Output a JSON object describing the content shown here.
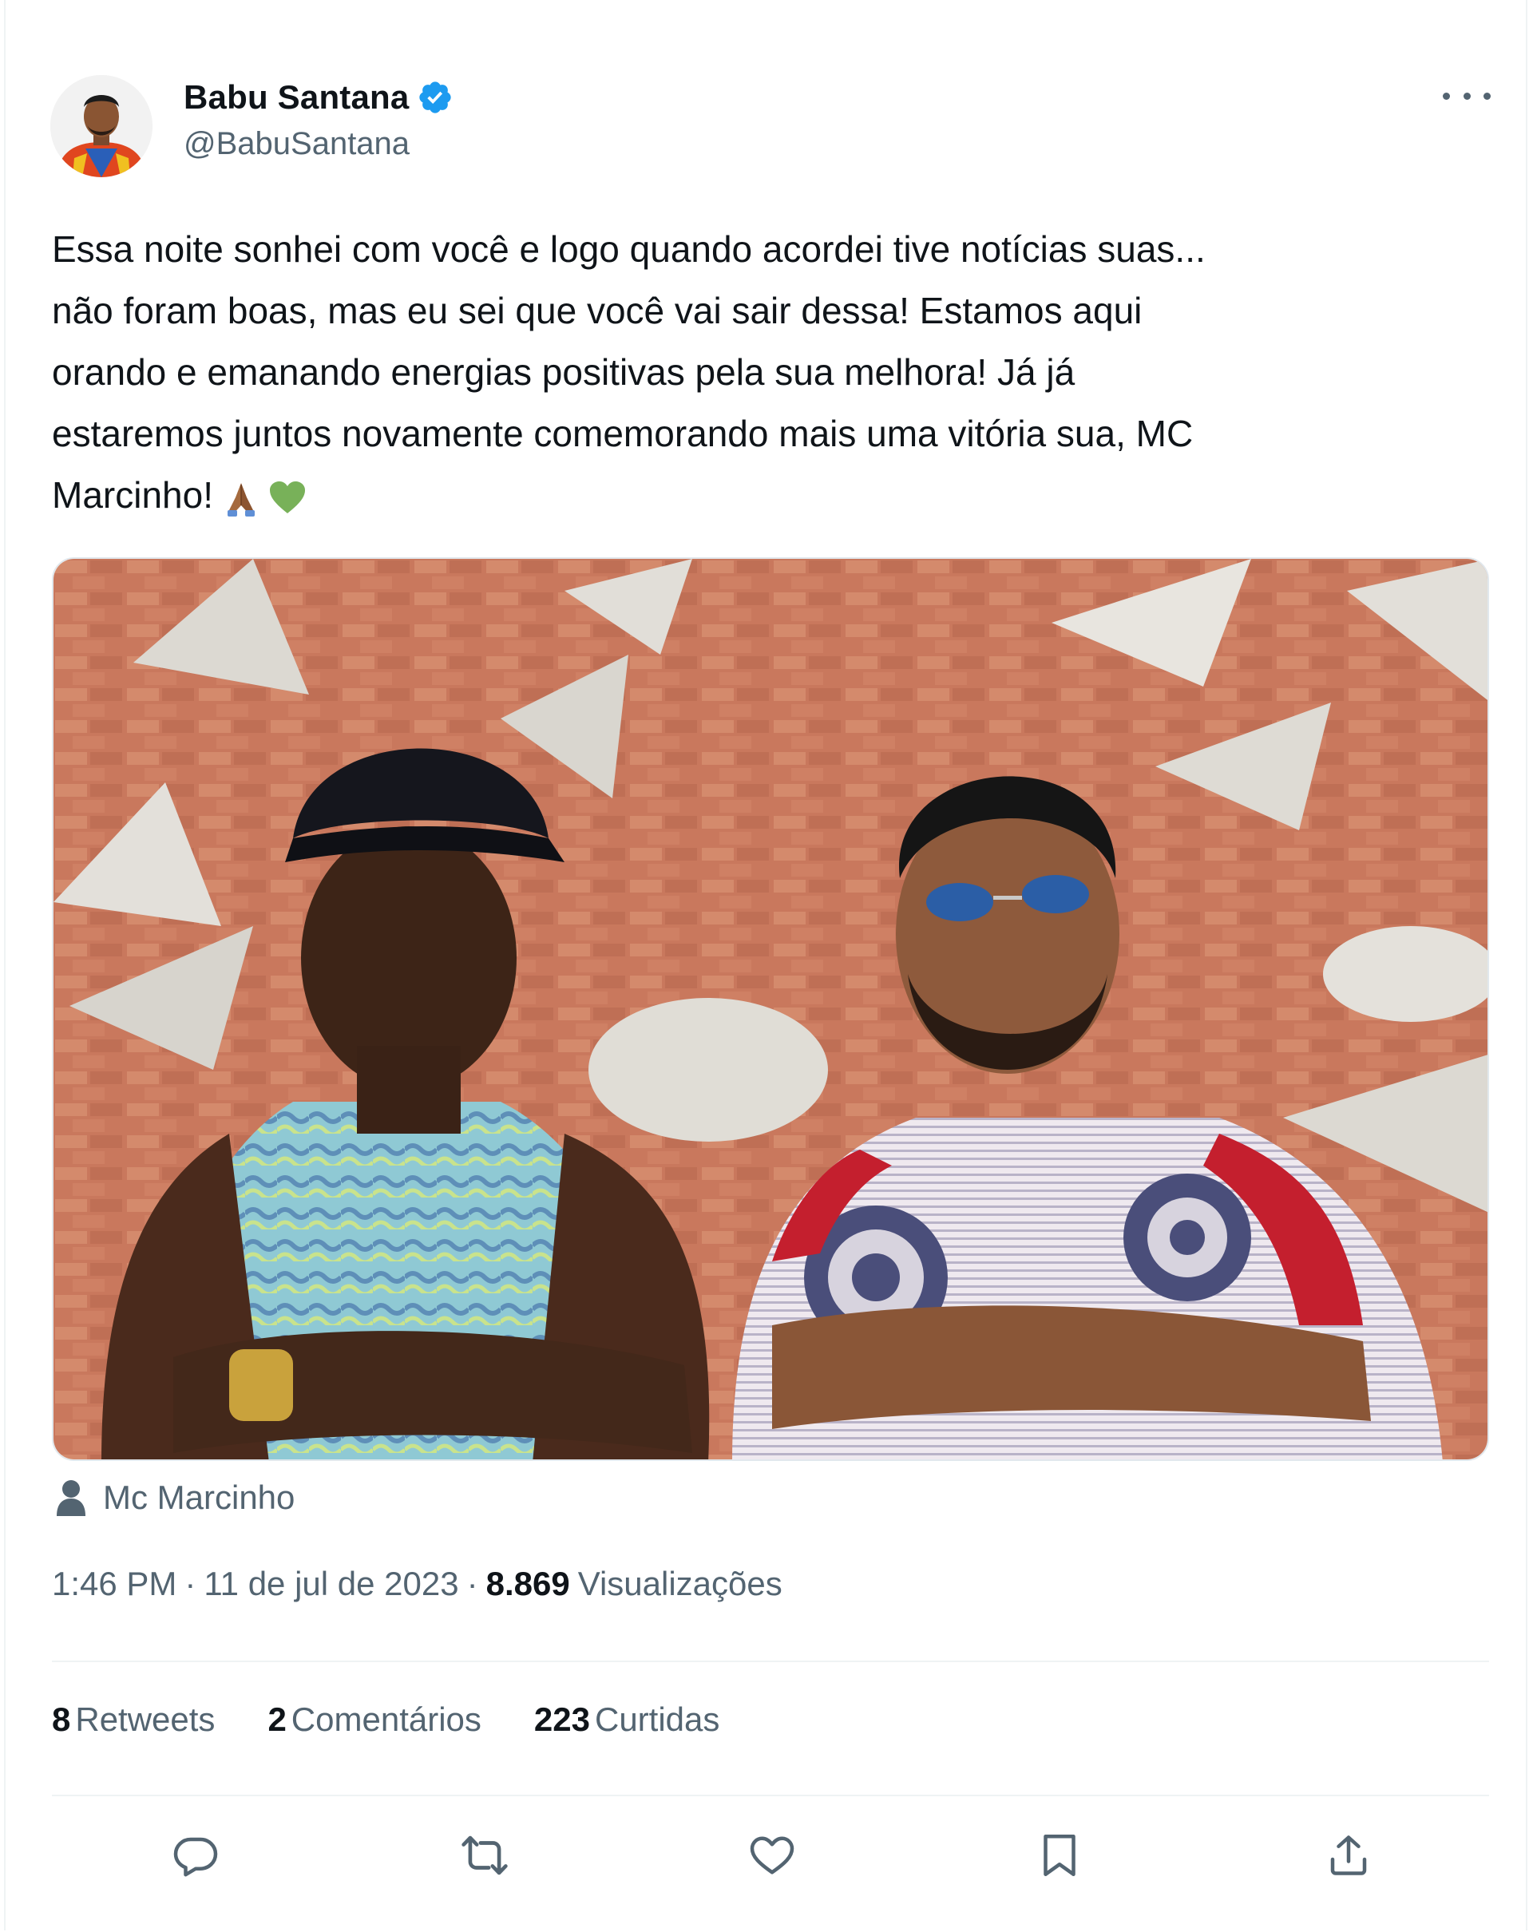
{
  "author": {
    "display_name": "Babu Santana",
    "handle": "@BabuSantana"
  },
  "tweet": {
    "text": "Essa noite sonhei com você e logo quando acordei tive notícias suas...\nnão foram boas, mas eu sei que você vai sair dessa! Estamos aqui\norando e emanando energias positivas pela sua melhora! Já já\nestaremos juntos novamente comemorando mais uma vitória sua, MC\nMarcinho!",
    "emojis": [
      "praying-hands-emoji",
      "green-heart-emoji"
    ]
  },
  "tagged_user": "Mc Marcinho",
  "meta": {
    "time": "1:46 PM",
    "separator": "·",
    "date": "11 de jul de 2023",
    "views_count": "8.869",
    "views_label": "Visualizações"
  },
  "stats": {
    "retweets_count": "8",
    "retweets_label": "Retweets",
    "comments_count": "2",
    "comments_label": "Comentários",
    "likes_count": "223",
    "likes_label": "Curtidas"
  },
  "colors": {
    "text_primary": "#0f1419",
    "text_secondary": "#536471",
    "verified_blue": "#1d9bf0",
    "divider": "#eff3f4"
  },
  "icons": {
    "more": "more-dots-icon",
    "reply": "reply-icon",
    "retweet": "retweet-icon",
    "like": "heart-icon",
    "bookmark": "bookmark-icon",
    "share": "share-icon",
    "person": "person-icon",
    "verified": "verified-badge-icon"
  }
}
